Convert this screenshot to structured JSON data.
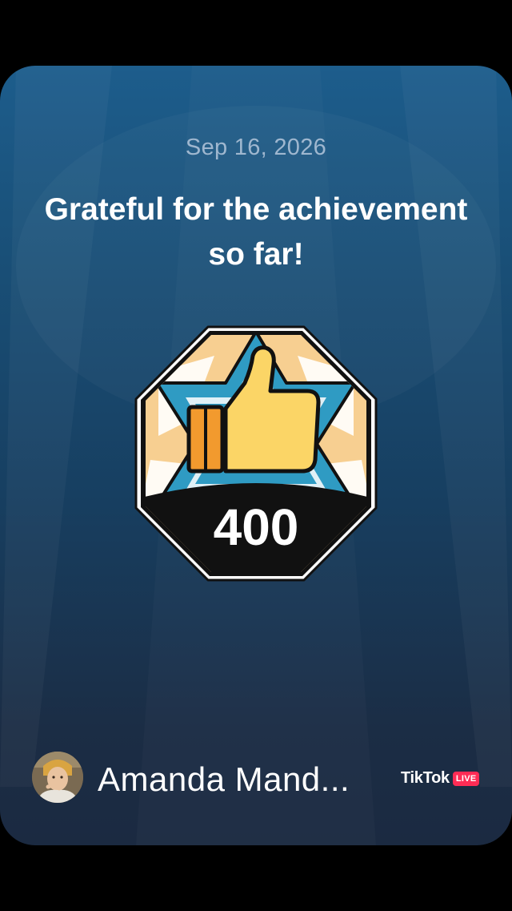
{
  "card": {
    "date": "Sep 16, 2026",
    "headline": "Grateful for the achievement so far!"
  },
  "badge": {
    "icon": "thumbs-up-icon",
    "count": "400",
    "colors": {
      "frame": "#111111",
      "outline": "#ffffff",
      "star": "#2f9bc3",
      "background": "#f7cf91",
      "thumb": "#fbd566",
      "cuff": "#f29a2e"
    }
  },
  "footer": {
    "username": "Amanda Mand...",
    "brand": "TikTok",
    "live_label": "LIVE"
  },
  "colors": {
    "card_top": "#1d5d8c",
    "card_bottom": "#1b2a41",
    "live_accent": "#fe2c55"
  }
}
